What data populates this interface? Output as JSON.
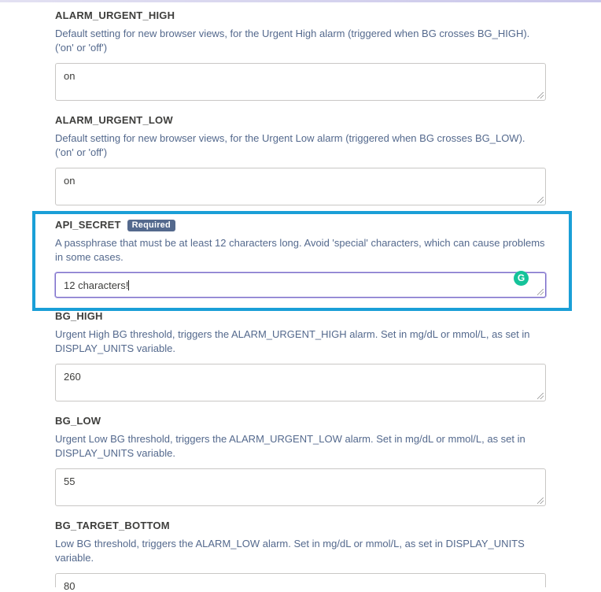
{
  "fields": [
    {
      "name": "ALARM_URGENT_HIGH",
      "description": "Default setting for new browser views, for the Urgent High alarm (triggered when BG crosses BG_HIGH). ('on' or 'off')",
      "value": "on"
    },
    {
      "name": "ALARM_URGENT_LOW",
      "description": "Default setting for new browser views, for the Urgent Low alarm (triggered when BG crosses BG_LOW). ('on' or 'off')",
      "value": "on"
    },
    {
      "name": "API_SECRET",
      "badge": "Required",
      "description": "A passphrase that must be at least 12 characters long. Avoid 'special' characters, which can cause problems in some cases.",
      "value": "12 characters!",
      "grammarly_glyph": "G"
    },
    {
      "name": "BG_HIGH",
      "description": "Urgent High BG threshold, triggers the ALARM_URGENT_HIGH alarm. Set in mg/dL or mmol/L, as set in DISPLAY_UNITS variable.",
      "value": "260"
    },
    {
      "name": "BG_LOW",
      "description": "Urgent Low BG threshold, triggers the ALARM_URGENT_LOW alarm. Set in mg/dL or mmol/L, as set in DISPLAY_UNITS variable.",
      "value": "55"
    },
    {
      "name": "BG_TARGET_BOTTOM",
      "description": "Low BG threshold, triggers the ALARM_LOW alarm. Set in mg/dL or mmol/L, as set in DISPLAY_UNITS variable.",
      "value": "80"
    }
  ],
  "colors": {
    "highlight": "#1a9fd7",
    "badge": "#54698d",
    "label": "#3e3e3c",
    "description": "#54698d",
    "grammarly": "#15c39a"
  }
}
